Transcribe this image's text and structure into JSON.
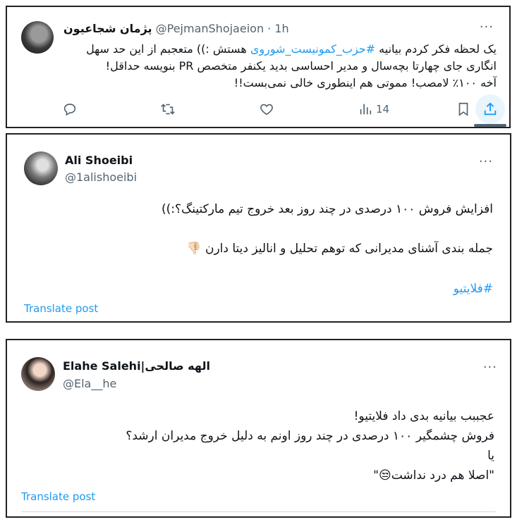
{
  "tweet1": {
    "name": "پژمان شجاعیون",
    "handle": "@PejmanShojaeion",
    "dot": "·",
    "time": "1h",
    "more": "···",
    "line1_pre": "یک لحظه فکر کردم بیانیه ",
    "hashtag": "#حزب_کمونیست_شوروی",
    "line1_post": " هستش :)) متعجبم از این حد سهل",
    "line2": "انگاری جای چهارتا بچه‌سال و مدیر احساسی بدید یکنفر متخصص PR بنویسه حداقل!",
    "line3": "آخه ۱۰۰٪ لامصب! مموتی هم اینطوری خالی نمی‌بست!!",
    "actions": {
      "views": "14"
    }
  },
  "tweet2": {
    "name": "Ali Shoeibi",
    "handle": "@1alishoeibi",
    "more": "···",
    "line1": "افزایش فروش ۱۰۰ درصدی در چند روز بعد خروج تیم مارکتینگ؟:))",
    "line2": "جمله بندی آشنای مدیرانی که توهم تحلیل و انالیز دیتا دارن",
    "emoji": "👎🏻",
    "hashtag": "#فلایتیو",
    "translate": "Translate post"
  },
  "tweet3": {
    "name": "Elahe Salehi|الهه صالحی",
    "handle": "@Ela__he",
    "more": "···",
    "line1": "عجببب بیانیه بدی داد فلایتیو!",
    "line2": "فروش چشمگیر ۱۰۰ درصدی در چند روز اونم به دلیل خروج مدیران ارشد؟",
    "line3": "یا",
    "line4": "\"اصلا هم درد نداشت😒\"",
    "translate": "Translate post"
  },
  "colors": {
    "accent": "#1d9bf0",
    "muted": "#536471",
    "text": "#0f1419",
    "border": "#222222"
  }
}
